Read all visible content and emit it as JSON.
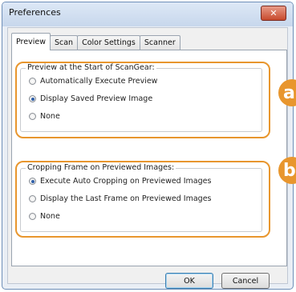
{
  "window": {
    "title": "Preferences",
    "close_symbol": "✕"
  },
  "tabs": [
    {
      "label": "Preview",
      "active": true
    },
    {
      "label": "Scan",
      "active": false
    },
    {
      "label": "Color Settings",
      "active": false
    },
    {
      "label": "Scanner",
      "active": false
    }
  ],
  "group_preview": {
    "legend": "Preview at the Start of ScanGear:",
    "options": [
      {
        "label": "Automatically Execute Preview",
        "checked": false
      },
      {
        "label": "Display Saved Preview Image",
        "checked": true
      },
      {
        "label": "None",
        "checked": false
      }
    ],
    "badge": "a"
  },
  "group_cropping": {
    "legend": "Cropping Frame on Previewed Images:",
    "options": [
      {
        "label": "Execute Auto Cropping on Previewed Images",
        "checked": true
      },
      {
        "label": "Display the Last Frame on Previewed Images",
        "checked": false
      },
      {
        "label": "None",
        "checked": false
      }
    ],
    "badge": "b"
  },
  "buttons": {
    "ok": "OK",
    "cancel": "Cancel"
  },
  "colors": {
    "highlight": "#e8962e",
    "radio_selected": "#2f5fa8"
  }
}
